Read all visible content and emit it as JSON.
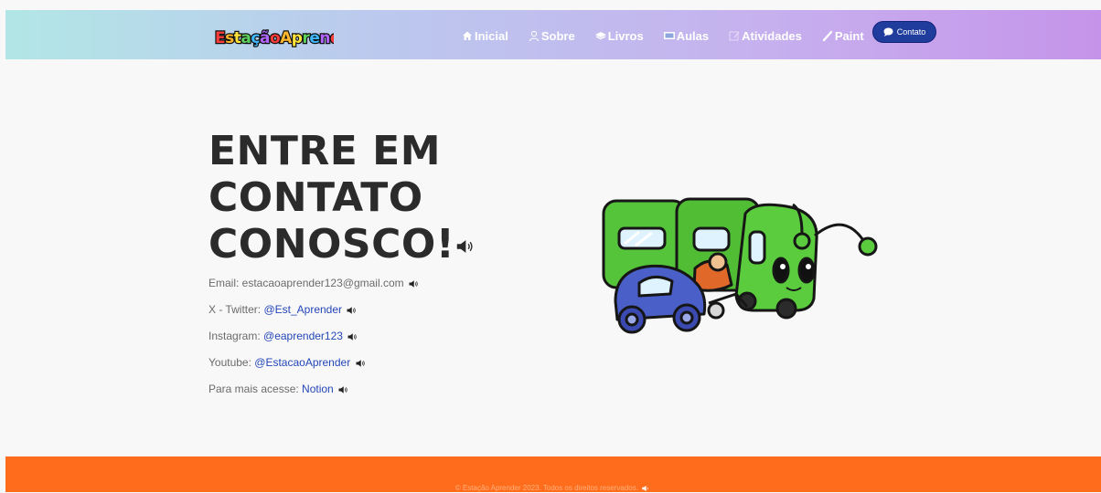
{
  "header": {
    "logo_text": "EstaçãoAprender",
    "nav": [
      {
        "label": "Inicial",
        "icon": "home-icon"
      },
      {
        "label": "Sobre",
        "icon": "user-icon"
      },
      {
        "label": "Livros",
        "icon": "book-icon"
      },
      {
        "label": "Aulas",
        "icon": "board-icon"
      },
      {
        "label": "Atividades",
        "icon": "notepad-icon"
      },
      {
        "label": "Paint",
        "icon": "brush-icon"
      }
    ],
    "contact_button": "Contato"
  },
  "main": {
    "heading": "ENTRE EM CONTATO CONOSCO!",
    "contacts": [
      {
        "label": "Email: estacaoaprender123@gmail.com",
        "link": ""
      },
      {
        "label": "X - Twitter: ",
        "link": "@Est_Aprender"
      },
      {
        "label": "Instagram: ",
        "link": "@eaprender123"
      },
      {
        "label": "Youtube: ",
        "link": "@EstacaoAprender"
      },
      {
        "label": "Para mais acesse: ",
        "link": "Notion"
      }
    ]
  },
  "footer": {
    "text": "© Estação Aprender 2023. Todos os direitos reservados."
  },
  "colors": {
    "accent": "#203d9e",
    "footer": "#ff6d1c",
    "link": "#2446b8",
    "train": "#56c43a"
  }
}
